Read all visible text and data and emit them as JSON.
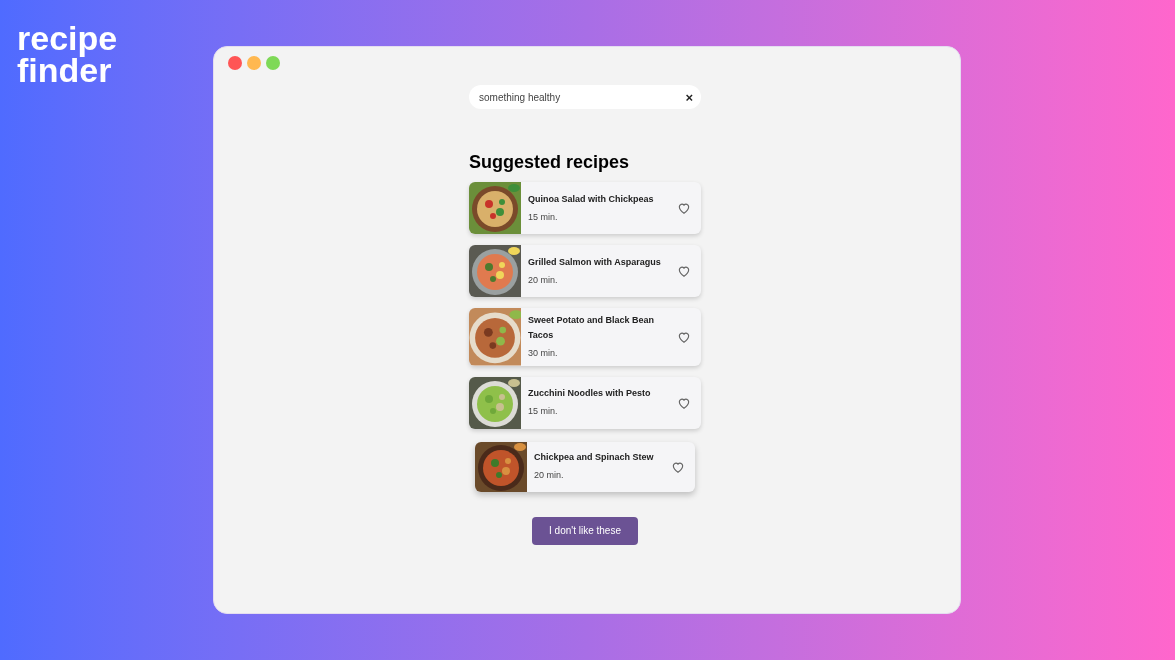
{
  "logo": {
    "lines": [
      "recipe",
      "finder"
    ]
  },
  "search": {
    "value": "something healthy",
    "clear": "×"
  },
  "heading": "Suggested recipes",
  "recipes": [
    {
      "title": "Quinoa Salad with Chickpeas",
      "time": "15 min.",
      "dragging": false
    },
    {
      "title": "Grilled Salmon with Asparagus",
      "time": "20 min.",
      "dragging": false
    },
    {
      "title": "Sweet Potato and Black Bean Tacos",
      "time": "30 min.",
      "dragging": false
    },
    {
      "title": "Zucchini Noodles with Pesto",
      "time": "15 min.",
      "dragging": false
    },
    {
      "title": "Chickpea and Spinach Stew",
      "time": "20 min.",
      "dragging": true
    }
  ],
  "button": "I don't like these"
}
